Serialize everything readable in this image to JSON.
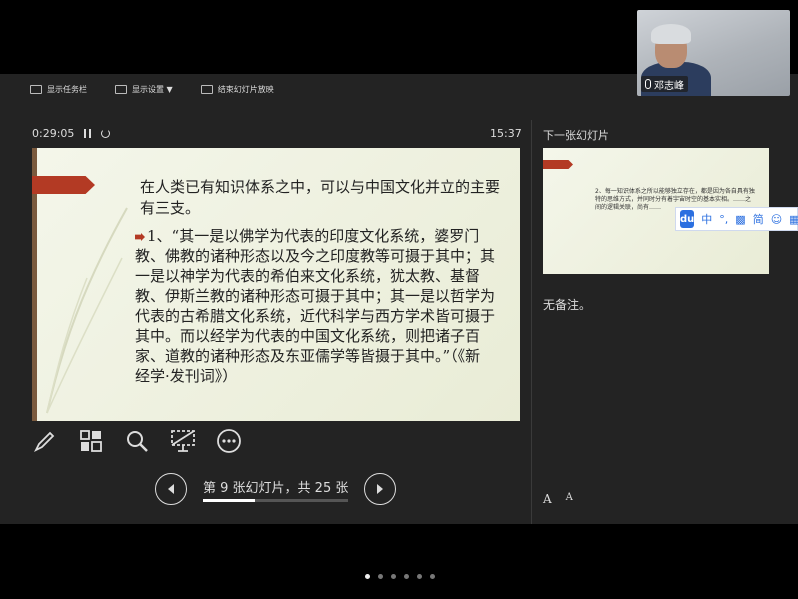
{
  "video": {
    "participant_name": "邓志峰"
  },
  "toolbar": {
    "show_taskbar": "显示任务栏",
    "display_settings": "显示设置 ▼",
    "end_slideshow": "结束幻灯片放映"
  },
  "timer": {
    "elapsed": "0:29:05",
    "clock": "15:37"
  },
  "current_slide": {
    "title": "在人类已有知识体系之中，可以与中国文化并立的主要有三支。",
    "body": "1、“其一是以佛学为代表的印度文化系统，婆罗门教、佛教的诸种形态以及今之印度教等可摄于其中；其一是以神学为代表的希伯来文化系统，犹太教、基督教、伊斯兰教的诸种形态可摄于其中；其一是以哲学为代表的古希腊文化系统，近代科学与西方学术皆可摄于其中。而以经学为代表的中国文化系统，则把诸子百家、道教的诸种形态及东亚儒学等皆摄于其中。”（《新经学·发刊词》）"
  },
  "navigation": {
    "slide_label": "第 9 张幻灯片，共 25 张",
    "current": 9,
    "total": 25,
    "progress_fraction": 0.36
  },
  "next_panel": {
    "label": "下一张幻灯片",
    "preview_text": "2、每一知识体系之所以能够独立存在，都是因为各自具有独特的思维方式，并同时分有着宇宙时空的基本实相。……之间的逻辑关联，尚有……"
  },
  "notes": {
    "text": "无备注。"
  },
  "font_controls": {
    "increase": "A",
    "decrease": "A"
  },
  "ime": {
    "logo": "du",
    "mode": "中",
    "punct": "°,",
    "simp": "简"
  },
  "pager": {
    "count": 6,
    "active_index": 0
  },
  "colors": {
    "accent_red": "#b33a24",
    "panel_bg": "#232323",
    "slide_bg": "#eef0de"
  }
}
